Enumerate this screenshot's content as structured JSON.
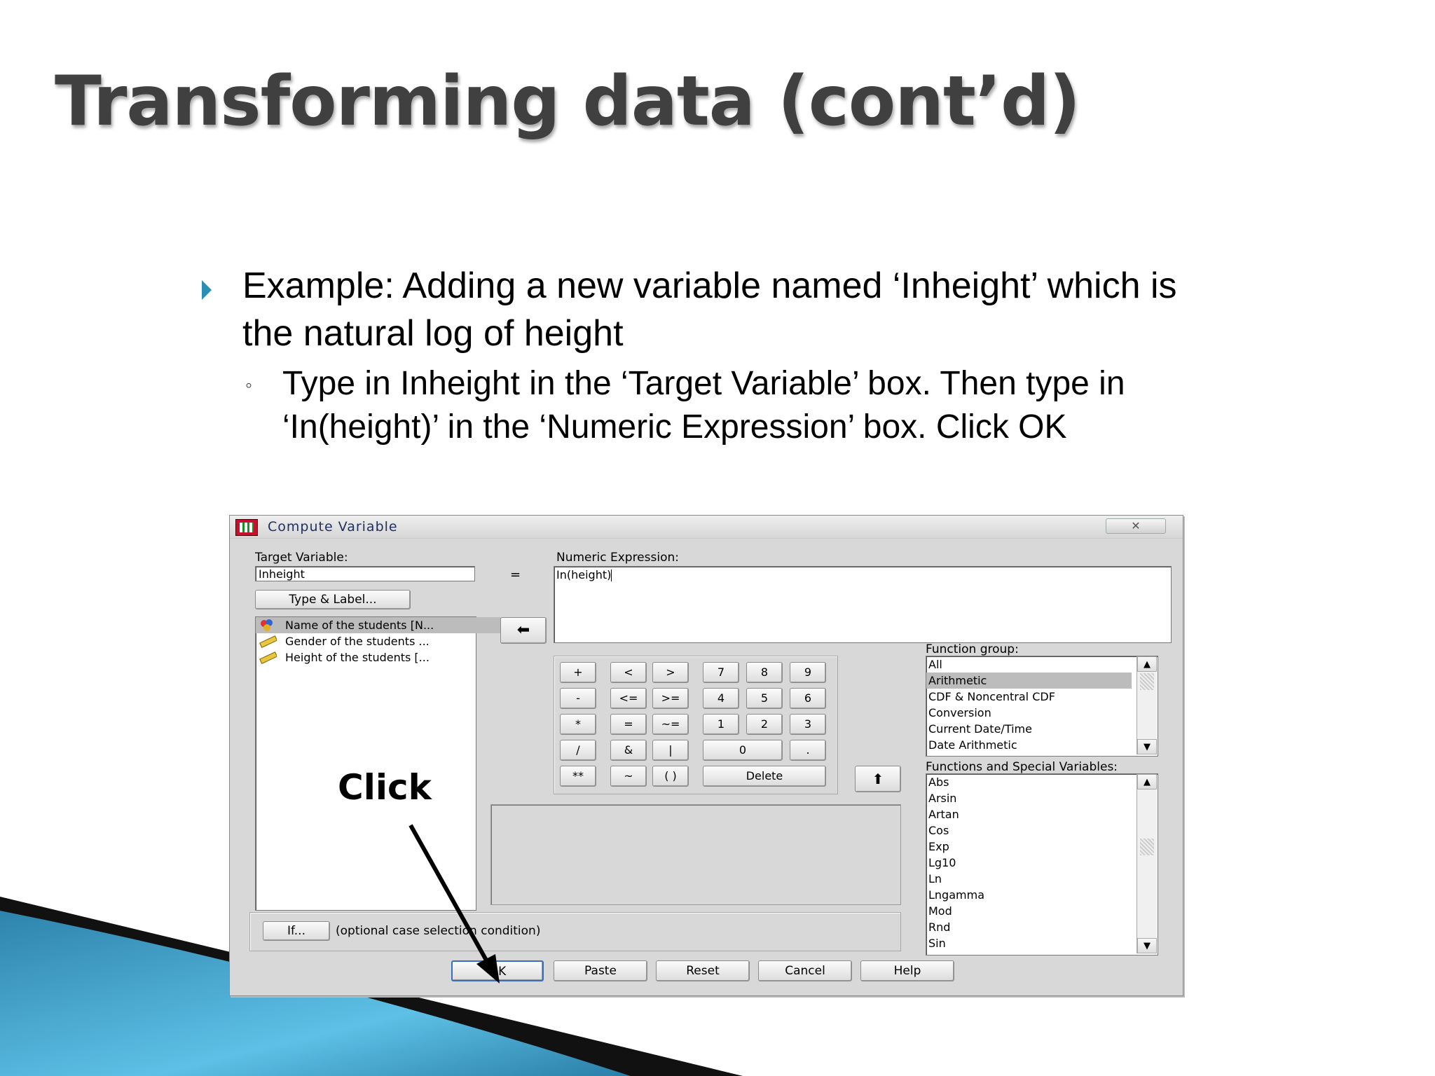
{
  "slide": {
    "title": "Transforming data (cont’d)",
    "bullet_line1": "Example: Adding a new variable named ‘Inheight’ which is",
    "bullet_line2": "the natural log of height",
    "sub_bullet_marker": "◦",
    "sub_line1": "Type in Inheight in the ‘Target Variable’ box. Then type in",
    "sub_line2": "‘In(height)’ in the ‘Numeric Expression’ box. Click OK",
    "annotation": "Click"
  },
  "dialog": {
    "title": "Compute Variable",
    "close_glyph": "✕",
    "target_label": "Target Variable:",
    "target_value": "Inheight",
    "equals": "=",
    "expr_label": "Numeric Expression:",
    "expr_value": "In(height)",
    "type_label_button": "Type & Label...",
    "variables": [
      {
        "label": "Name of the students [N...",
        "icon": "nominal-variable-icon"
      },
      {
        "label": "Gender of the students ...",
        "icon": "scale-ruler-icon"
      },
      {
        "label": "Height of the students [...",
        "icon": "scale-ruler-icon"
      }
    ],
    "keypad": {
      "rows": [
        [
          "+",
          "<",
          ">",
          "7",
          "8",
          "9"
        ],
        [
          "-",
          "<=",
          ">=",
          "4",
          "5",
          "6"
        ],
        [
          "*",
          "=",
          "~=",
          "1",
          "2",
          "3"
        ],
        [
          "/",
          "&",
          "|",
          "0",
          "."
        ],
        [
          "**",
          "~",
          "( )",
          "Delete"
        ]
      ]
    },
    "function_group_label": "Function group:",
    "function_groups": [
      "All",
      "Arithmetic",
      "CDF & Noncentral CDF",
      "Conversion",
      "Current Date/Time",
      "Date Arithmetic"
    ],
    "function_group_selected": "Arithmetic",
    "functions_label": "Functions and Special Variables:",
    "functions": [
      "Abs",
      "Arsin",
      "Artan",
      "Cos",
      "Exp",
      "Lg10",
      "Ln",
      "Lngamma",
      "Mod",
      "Rnd",
      "Sin"
    ],
    "if_button": "If...",
    "if_hint": "(optional case selection condition)",
    "buttons": [
      "OK",
      "Paste",
      "Reset",
      "Cancel",
      "Help"
    ]
  },
  "colors": {
    "bullet_accent": "#2b8fb5",
    "dialog_bg": "#d8d8d8",
    "selection": "#bcbcbc"
  }
}
